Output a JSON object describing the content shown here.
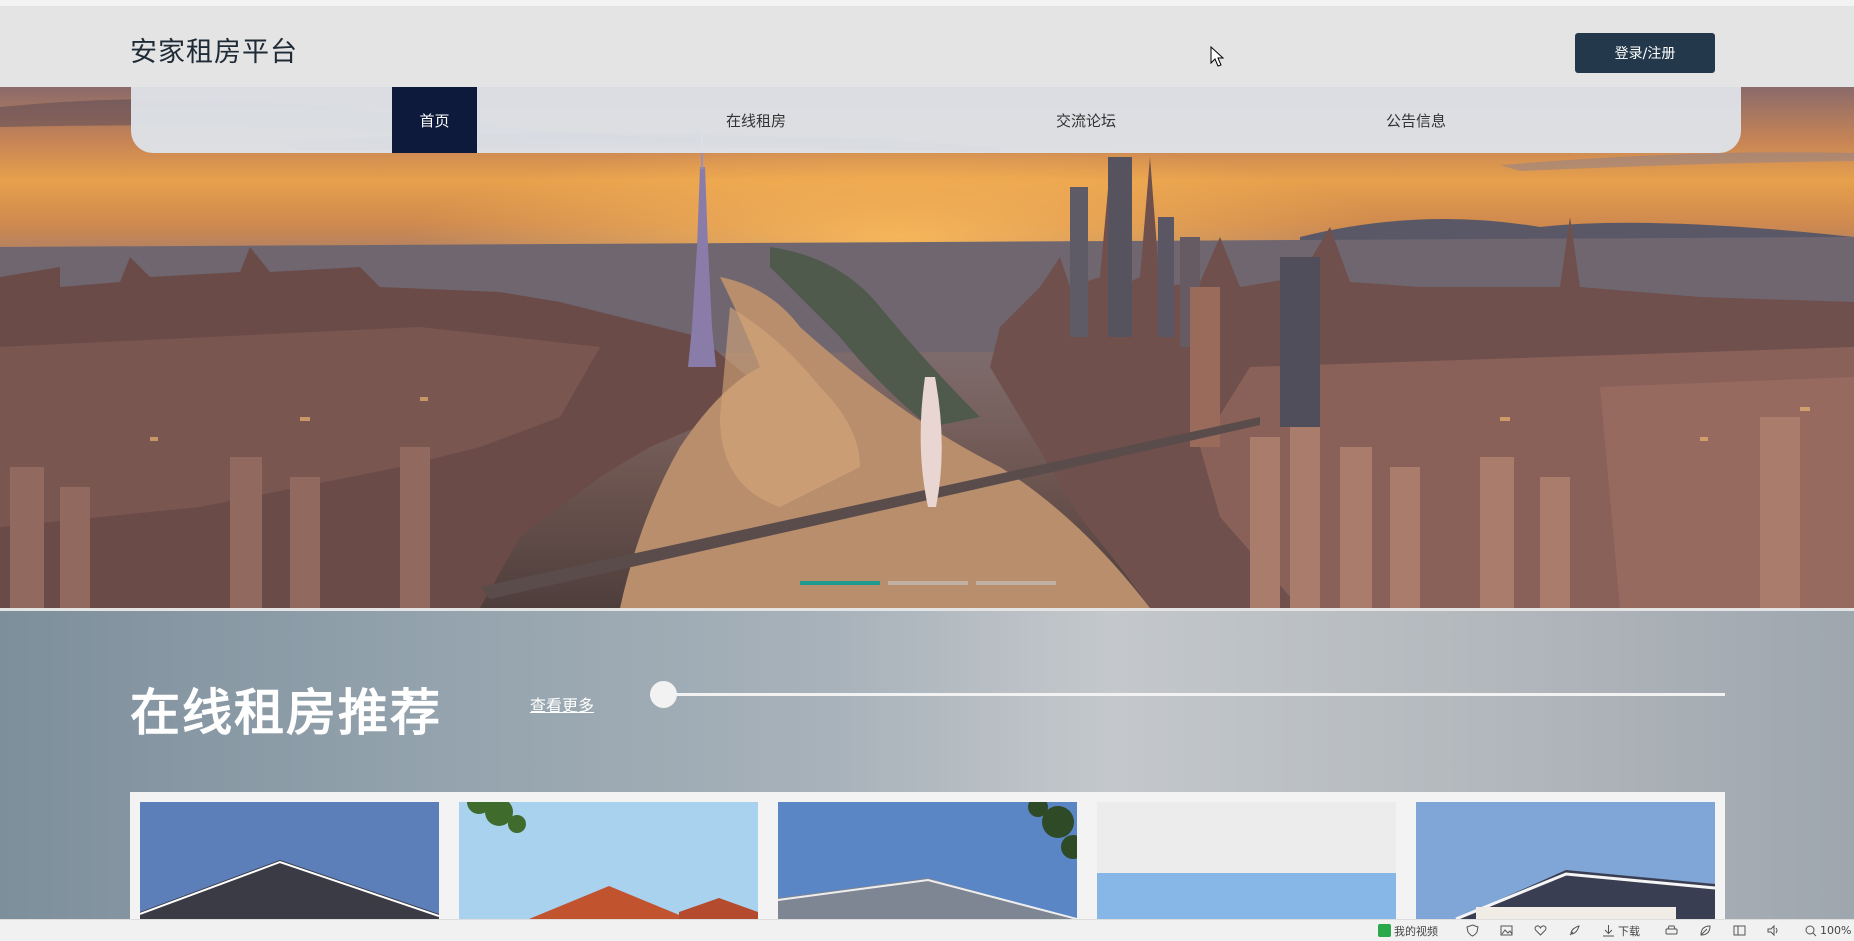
{
  "header": {
    "site_title": "安家租房平台",
    "login_label": "登录/注册"
  },
  "nav": {
    "items": [
      "首页",
      "在线租房",
      "交流论坛",
      "公告信息"
    ],
    "active_index": 0
  },
  "carousel": {
    "slide_count": 3,
    "active_slide": 0
  },
  "recommend": {
    "title": "在线租房推荐",
    "more_label": "查看更多",
    "slider_value": 0
  },
  "statusbar": {
    "video_label": "我的视频",
    "download_label": "下载",
    "zoom_label": "100%"
  },
  "colors": {
    "nav_active_bg": "#0e1a3c",
    "login_bg": "#23394b",
    "carousel_active": "#1f9a8c"
  }
}
